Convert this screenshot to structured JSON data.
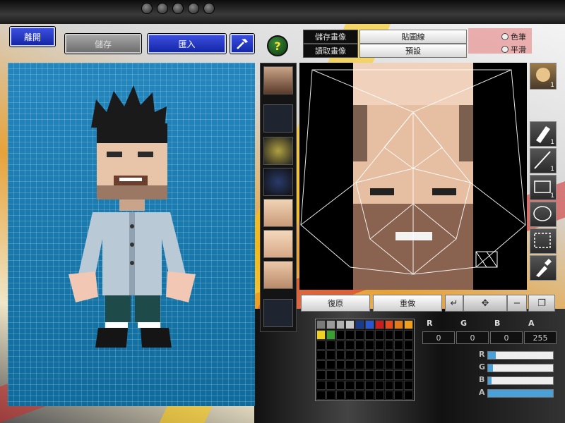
{
  "toolbar": {
    "exit_label": "離開",
    "save_label": "儲存",
    "import_label": "匯入",
    "help_glyph": "?"
  },
  "texture": {
    "save_image_label": "儲存畫像",
    "load_image_label": "讀取畫像",
    "texture_line_label": "貼圖線",
    "preset_label": "預設",
    "radio_color_label": "色筆",
    "radio_smooth_label": "平滑"
  },
  "thumbnails": [
    "face-thumb",
    "empty-slot",
    "dragon-armor-thumb",
    "dark-thumb",
    "face-skin-1",
    "face-skin-2",
    "face-skin-3",
    "empty-slot-2"
  ],
  "tools": [
    {
      "name": "pen-tool-icon",
      "count": "1"
    },
    {
      "name": "line-tool-icon",
      "count": "1"
    },
    {
      "name": "rect-tool-icon",
      "count": "1"
    },
    {
      "name": "ellipse-tool-icon",
      "count": ""
    },
    {
      "name": "select-tool-icon",
      "count": ""
    },
    {
      "name": "eyedropper-tool-icon",
      "count": ""
    }
  ],
  "avatar_badge": {
    "count": "1"
  },
  "edit": {
    "restore_label": "復原",
    "redo_label": "重做"
  },
  "color": {
    "r_label": "R",
    "g_label": "G",
    "b_label": "B",
    "a_label": "A",
    "r_value": "0",
    "g_value": "0",
    "b_value": "0",
    "a_value": "255",
    "sliders": [
      0.12,
      0.08,
      0.05,
      1.0
    ],
    "side_letters": [
      "R",
      "G",
      "B",
      "A"
    ]
  },
  "palette_colors": [
    "#7a7a7a",
    "#9a9a9a",
    "#b0b0b0",
    "#c8c8c8",
    "#1a3a8a",
    "#2a56d0",
    "#c81e1e",
    "#e04a1e",
    "#e07a1a",
    "#f0a020",
    "#f0d020",
    "#3aa030"
  ]
}
